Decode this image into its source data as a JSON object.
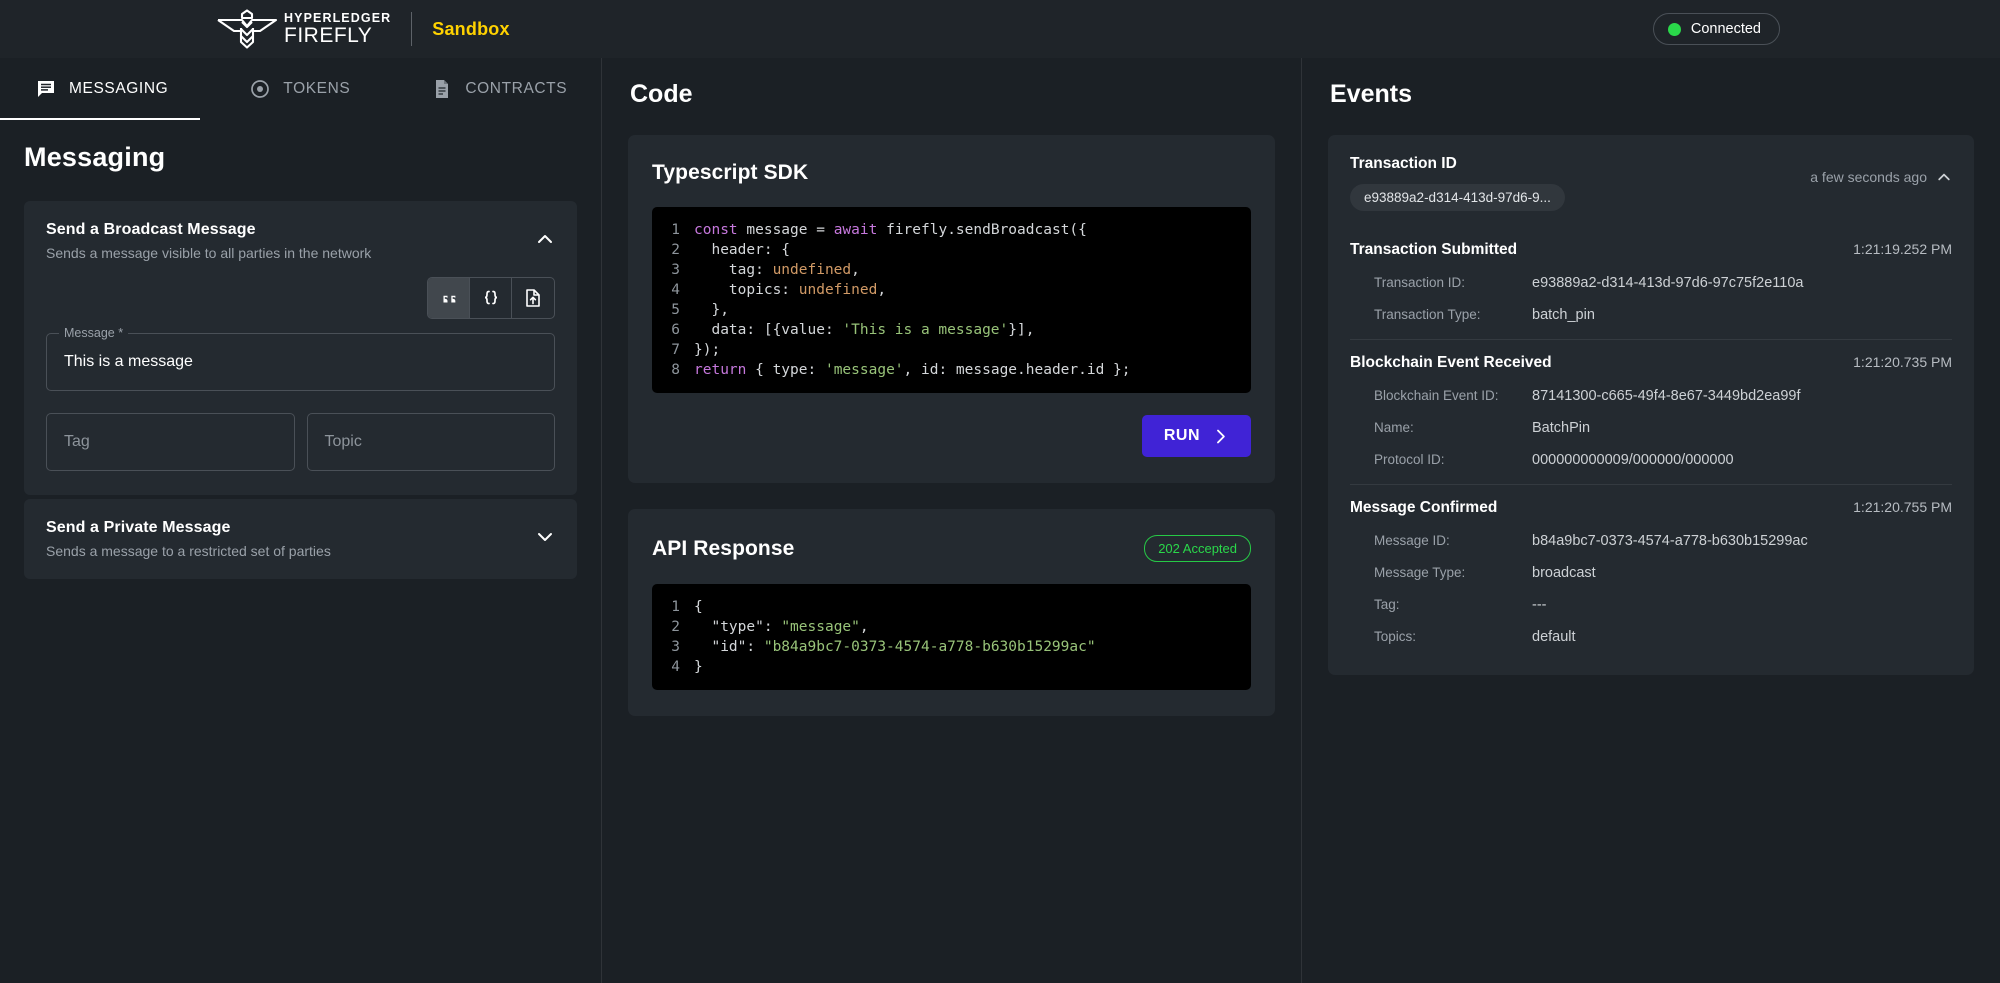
{
  "header": {
    "brand_top": "HYPERLEDGER",
    "brand_bottom": "FIREFLY",
    "sandbox_label": "Sandbox",
    "status_label": "Connected",
    "status_color": "#2ad84a",
    "sandbox_color": "#ffd200"
  },
  "tabs": [
    {
      "label": "MESSAGING",
      "icon": "message-icon",
      "active": true
    },
    {
      "label": "TOKENS",
      "icon": "token-icon",
      "active": false
    },
    {
      "label": "CONTRACTS",
      "icon": "contract-icon",
      "active": false
    }
  ],
  "left": {
    "page_title": "Messaging",
    "broadcast": {
      "title": "Send a Broadcast Message",
      "subtitle": "Sends a message visible to all parties in the network",
      "chevron": "chevron-up-icon",
      "toggles": [
        {
          "icon": "quote-icon",
          "selected": true
        },
        {
          "icon": "braces-icon",
          "selected": false
        },
        {
          "icon": "file-upload-icon",
          "selected": false
        }
      ],
      "message_label": "Message *",
      "message_value": "This is a message",
      "tag_placeholder": "Tag",
      "topic_placeholder": "Topic"
    },
    "private": {
      "title": "Send a Private Message",
      "subtitle": "Sends a message to a restricted set of parties",
      "chevron": "chevron-down-icon"
    }
  },
  "code_panel": {
    "heading": "Code",
    "sdk_title": "Typescript SDK",
    "run_label": "RUN",
    "sdk_lines": [
      {
        "n": "1",
        "parts": [
          {
            "t": "const ",
            "c": "key"
          },
          {
            "t": "message = ",
            "c": "txt"
          },
          {
            "t": "await ",
            "c": "key"
          },
          {
            "t": "firefly.sendBroadcast({",
            "c": "txt"
          }
        ]
      },
      {
        "n": "2",
        "parts": [
          {
            "t": "  header: {",
            "c": "txt"
          }
        ]
      },
      {
        "n": "3",
        "parts": [
          {
            "t": "    tag: ",
            "c": "txt"
          },
          {
            "t": "undefined",
            "c": "undef"
          },
          {
            "t": ",",
            "c": "txt"
          }
        ]
      },
      {
        "n": "4",
        "parts": [
          {
            "t": "    topics: ",
            "c": "txt"
          },
          {
            "t": "undefined",
            "c": "undef"
          },
          {
            "t": ",",
            "c": "txt"
          }
        ]
      },
      {
        "n": "5",
        "parts": [
          {
            "t": "  },",
            "c": "txt"
          }
        ]
      },
      {
        "n": "6",
        "parts": [
          {
            "t": "  data: [{value: ",
            "c": "txt"
          },
          {
            "t": "'This is a message'",
            "c": "str"
          },
          {
            "t": "}],",
            "c": "txt"
          }
        ]
      },
      {
        "n": "7",
        "parts": [
          {
            "t": "});",
            "c": "txt"
          }
        ]
      },
      {
        "n": "8",
        "parts": [
          {
            "t": "return",
            "c": "key"
          },
          {
            "t": " { type: ",
            "c": "txt"
          },
          {
            "t": "'message'",
            "c": "str"
          },
          {
            "t": ", id: message.header.id };",
            "c": "txt"
          }
        ]
      }
    ],
    "api_title": "API Response",
    "api_badge": "202 Accepted",
    "api_lines": [
      {
        "n": "1",
        "parts": [
          {
            "t": "{",
            "c": "txt"
          }
        ]
      },
      {
        "n": "2",
        "parts": [
          {
            "t": "  \"type\": ",
            "c": "txt"
          },
          {
            "t": "\"message\"",
            "c": "str"
          },
          {
            "t": ",",
            "c": "txt"
          }
        ]
      },
      {
        "n": "3",
        "parts": [
          {
            "t": "  \"id\": ",
            "c": "txt"
          },
          {
            "t": "\"b84a9bc7-0373-4574-a778-b630b15299ac\"",
            "c": "str"
          }
        ]
      },
      {
        "n": "4",
        "parts": [
          {
            "t": "}",
            "c": "txt"
          }
        ]
      }
    ]
  },
  "events_panel": {
    "heading": "Events",
    "txid_label": "Transaction ID",
    "txid_chip": "e93889a2-d314-413d-97d6-9...",
    "ago_label": "a few seconds ago",
    "ago_chevron": "chevron-up-icon",
    "groups": [
      {
        "name": "Transaction Submitted",
        "time": "1:21:19.252 PM",
        "rows": [
          {
            "key": "Transaction ID:",
            "value": "e93889a2-d314-413d-97d6-97c75f2e110a"
          },
          {
            "key": "Transaction Type:",
            "value": "batch_pin"
          }
        ]
      },
      {
        "name": "Blockchain Event Received",
        "time": "1:21:20.735 PM",
        "rows": [
          {
            "key": "Blockchain Event ID:",
            "value": "87141300-c665-49f4-8e67-3449bd2ea99f"
          },
          {
            "key": "Name:",
            "value": "BatchPin"
          },
          {
            "key": "Protocol ID:",
            "value": "000000000009/000000/000000"
          }
        ]
      },
      {
        "name": "Message Confirmed",
        "time": "1:21:20.755 PM",
        "rows": [
          {
            "key": "Message ID:",
            "value": "b84a9bc7-0373-4574-a778-b630b15299ac"
          },
          {
            "key": "Message Type:",
            "value": "broadcast"
          },
          {
            "key": "Tag:",
            "value": "---"
          },
          {
            "key": "Topics:",
            "value": "default"
          }
        ]
      }
    ]
  }
}
